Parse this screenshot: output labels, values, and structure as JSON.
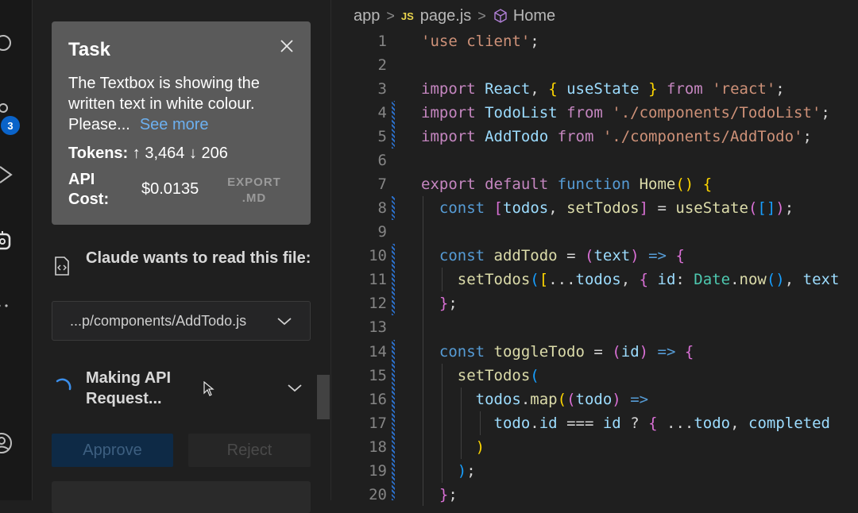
{
  "activity_bar": {
    "badge_count": "3"
  },
  "task": {
    "title": "Task",
    "text": "The Textbox is showing the written text in white colour. Please...",
    "see_more": "See more",
    "tokens_label": "Tokens:",
    "tokens_up": "↑ 3,464",
    "tokens_down": "↓ 206",
    "api_cost_label_1": "API",
    "api_cost_label_2": "Cost:",
    "api_cost_value": "$0.0135",
    "export_1": "EXPORT",
    "export_2": ".MD"
  },
  "read_request": {
    "title": "Claude wants to read this file:",
    "file": "...p/components/AddTodo.js"
  },
  "api_status": {
    "line1": "Making API",
    "line2": "Request..."
  },
  "buttons": {
    "approve": "Approve",
    "reject": "Reject"
  },
  "breadcrumb": {
    "folder": "app",
    "js_badge": "JS",
    "file": "page.js",
    "symbol": "Home"
  },
  "colors": {
    "accent": "#0a63c9",
    "task_bg": "#5a5a5a",
    "link": "#6cb0f0"
  }
}
